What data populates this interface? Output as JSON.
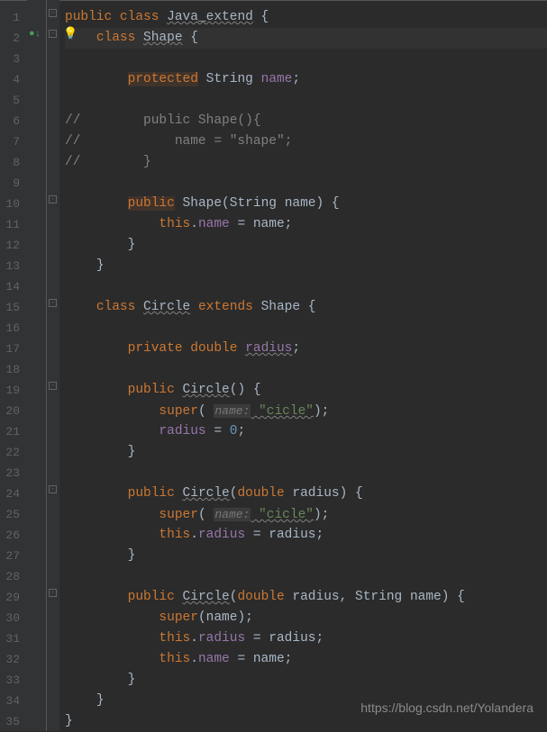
{
  "watermark": "https://blog.csdn.net/Yolandera",
  "lines": {
    "l1_kw1": "public",
    "l1_kw2": "class",
    "l1_cls": "Java_extend",
    "l1_brace": " {",
    "l2_kw": "class",
    "l2_cls": "Shape",
    "l2_brace": " {",
    "l4_kw": "protected",
    "l4_type": " String ",
    "l4_fld": "name",
    "l4_semi": ";",
    "l6_cmt": "//        public Shape(){",
    "l7_cmt": "//            name = \"shape\";",
    "l8_cmt": "//        }",
    "l10_kw": "public",
    "l10_ctor": " Shape(",
    "l10_ptype": "String ",
    "l10_pname": "name",
    "l10_after": ") {",
    "l11_this": "this",
    "l11_dot": ".",
    "l11_fld": "name",
    "l11_eq": " = name;",
    "l12_brace": "}",
    "l13_brace": "}",
    "l15_kw1": "class",
    "l15_cls": "Circle",
    "l15_kw2": "extends",
    "l15_sup": " Shape {",
    "l17_kw1": "private",
    "l17_kw2": "double",
    "l17_fld": "radius",
    "l17_semi": ";",
    "l19_kw": "public",
    "l19_ctor": "Circle",
    "l19_after": "() {",
    "l20_super": "super",
    "l20_open": "( ",
    "l20_hint": "name:",
    "l20_str": " \"cicle\"",
    "l20_close": ");",
    "l21_fld": "radius",
    "l21_eq": " = ",
    "l21_num": "0",
    "l21_semi": ";",
    "l22_brace": "}",
    "l24_kw": "public",
    "l24_ctor": "Circle",
    "l24_open": "(",
    "l24_ptype": "double ",
    "l24_pname": "radius",
    "l24_close": ") {",
    "l25_super": "super",
    "l25_open": "( ",
    "l25_hint": "name:",
    "l25_str": " \"cicle\"",
    "l25_close": ");",
    "l26_this": "this",
    "l26_dot": ".",
    "l26_fld": "radius",
    "l26_eq": " = radius;",
    "l27_brace": "}",
    "l29_kw": "public",
    "l29_ctor": "Circle",
    "l29_open": "(",
    "l29_t1": "double ",
    "l29_p1": "radius",
    "l29_comma": ", ",
    "l29_t2": "String ",
    "l29_p2": "name",
    "l29_close": ") {",
    "l30_super": "super",
    "l30_args": "(name);",
    "l31_this": "this",
    "l31_dot": ".",
    "l31_fld": "radius",
    "l31_eq": " = radius;",
    "l32_this": "this",
    "l32_dot": ".",
    "l32_fld": "name",
    "l32_eq": " = name;",
    "l33_brace": "}",
    "l34_brace": "}",
    "l35_brace": "}"
  },
  "nums": [
    "1",
    "2",
    "3",
    "4",
    "5",
    "6",
    "7",
    "8",
    "9",
    "10",
    "11",
    "12",
    "13",
    "14",
    "15",
    "16",
    "17",
    "18",
    "19",
    "20",
    "21",
    "22",
    "23",
    "24",
    "25",
    "26",
    "27",
    "28",
    "29",
    "30",
    "31",
    "32",
    "33",
    "34",
    "35"
  ]
}
